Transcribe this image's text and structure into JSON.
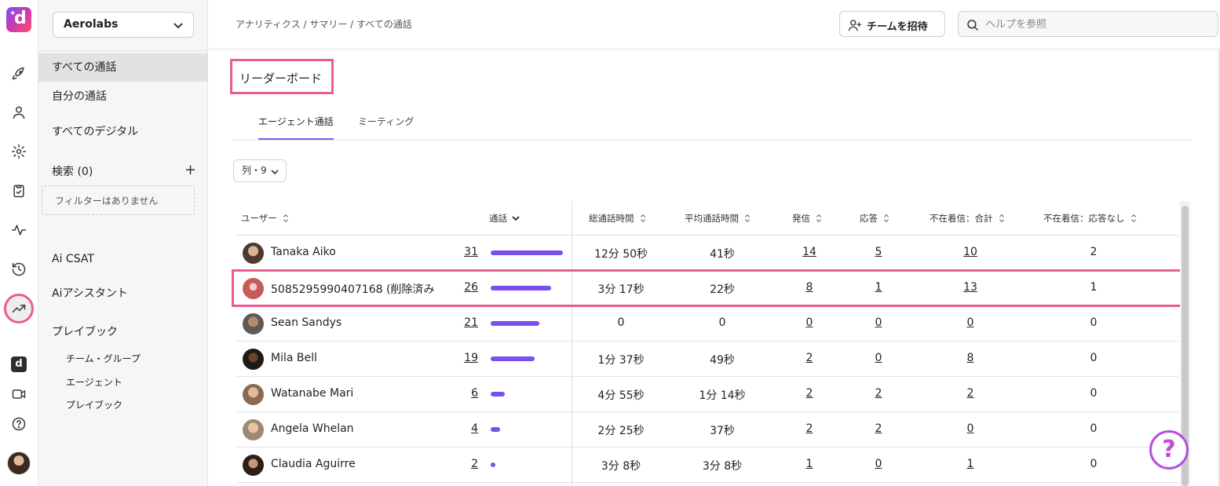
{
  "app": {
    "org": "Aerolabs",
    "breadcrumb": "アナリティクス / サマリー / すべての通話",
    "invite_label": "チームを招待",
    "help_search_placeholder": "ヘルプを参照",
    "logo_letter": "d"
  },
  "rail_icons": [
    "rocket-icon",
    "user-icon",
    "gear-icon",
    "clipboard-icon",
    "pulse-icon",
    "history-icon",
    "trend-icon",
    "dialpad-icon",
    "video-icon",
    "help-icon"
  ],
  "sidebar": {
    "items": [
      {
        "label": "すべての通話",
        "selected": true
      },
      {
        "label": "自分の通話"
      },
      {
        "label": "すべてのデジタル"
      }
    ],
    "search_label": "検索 (0)",
    "filter_empty": "フィルターはありません",
    "links": [
      "Ai CSAT",
      "Aiアシスタント",
      "プレイブック"
    ],
    "sub_links": [
      "チーム・グループ",
      "エージェント",
      "プレイブック"
    ]
  },
  "main": {
    "title": "リーダーボード",
    "tabs": [
      {
        "label": "エージェント通話",
        "active": true
      },
      {
        "label": "ミーティング"
      }
    ],
    "columns_button": "列・9",
    "headers": [
      "ユーザー",
      "通話",
      "総通話時間",
      "平均通話時間",
      "発信",
      "応答",
      "不在着信：合計",
      "不在着信：応答なし"
    ],
    "max_calls": 31,
    "rows": [
      {
        "name": "Tanaka Aiko",
        "calls": "31",
        "total": "12分 50秒",
        "avg": "41秒",
        "out": "14",
        "ans": "5",
        "missed": "10",
        "noans": "2"
      },
      {
        "name": "5085295990407168 (削除済み",
        "calls": "26",
        "total": "3分 17秒",
        "avg": "22秒",
        "out": "8",
        "ans": "1",
        "missed": "13",
        "noans": "1"
      },
      {
        "name": "Sean Sandys",
        "calls": "21",
        "total": "0",
        "avg": "0",
        "out": "0",
        "ans": "0",
        "missed": "0",
        "noans": "0"
      },
      {
        "name": "Mila Bell",
        "calls": "19",
        "total": "1分 37秒",
        "avg": "49秒",
        "out": "2",
        "ans": "0",
        "missed": "8",
        "noans": "0"
      },
      {
        "name": "Watanabe Mari",
        "calls": "6",
        "total": "4分 55秒",
        "avg": "1分 14秒",
        "out": "2",
        "ans": "2",
        "missed": "2",
        "noans": "0"
      },
      {
        "name": "Angela Whelan",
        "calls": "4",
        "total": "2分 25秒",
        "avg": "37秒",
        "out": "2",
        "ans": "2",
        "missed": "0",
        "noans": "0"
      },
      {
        "name": "Claudia Aguirre",
        "calls": "2",
        "total": "3分 8秒",
        "avg": "3分 8秒",
        "out": "1",
        "ans": "0",
        "missed": "1",
        "noans": "0"
      }
    ]
  },
  "colors": {
    "accent": "#7b4ef0",
    "highlight": "#ec5b8e",
    "help_fab": "#c24ad6"
  },
  "help_fab_label": "?"
}
